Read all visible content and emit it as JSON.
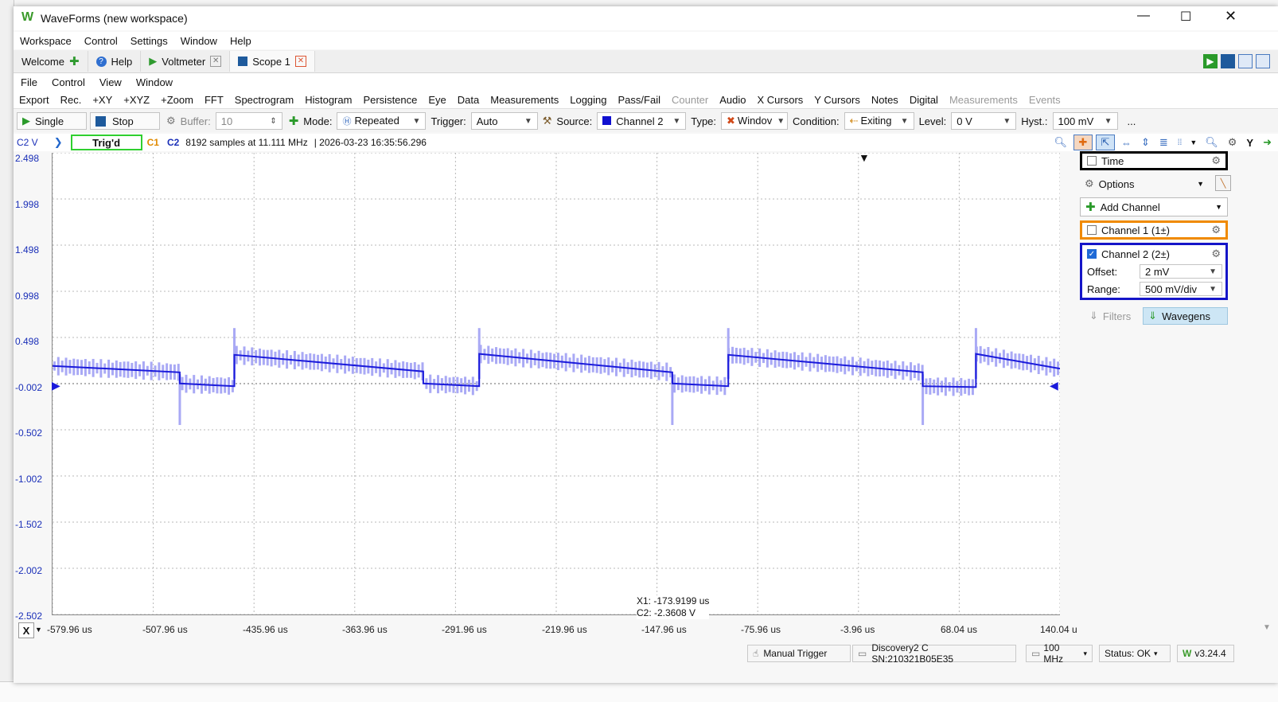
{
  "window": {
    "title": "WaveForms (new workspace)"
  },
  "menu": [
    "Workspace",
    "Control",
    "Settings",
    "Window",
    "Help"
  ],
  "tabs": [
    {
      "label": "Welcome"
    },
    {
      "label": "Help"
    },
    {
      "label": "Voltmeter"
    },
    {
      "label": "Scope 1"
    }
  ],
  "scope_menu": [
    "File",
    "Control",
    "View",
    "Window"
  ],
  "scope_tabs": [
    "Export",
    "Rec.",
    "+XY",
    "+XYZ",
    "+Zoom",
    "FFT",
    "Spectrogram",
    "Histogram",
    "Persistence",
    "Eye",
    "Data",
    "Measurements",
    "Logging",
    "Pass/Fail",
    "Counter",
    "Audio",
    "X Cursors",
    "Y Cursors",
    "Notes",
    "Digital",
    "Measurements",
    "Events"
  ],
  "controls": {
    "single": "Single",
    "stop": "Stop",
    "buffer_label": "Buffer:",
    "buffer_value": "10",
    "mode_label": "Mode:",
    "mode_value": "Repeated",
    "trigger_label": "Trigger:",
    "trigger_value": "Auto",
    "source_label": "Source:",
    "source_value": "Channel 2",
    "type_label": "Type:",
    "type_value": "Windov",
    "condition_label": "Condition:",
    "condition_value": "Exiting",
    "level_label": "Level:",
    "level_value": "0 V",
    "hyst_label": "Hyst.:",
    "hyst_value": "100 mV",
    "more": "..."
  },
  "info": {
    "channel_unit": "C2 V",
    "status": "Trig'd",
    "c1": "C1",
    "c2": "C2",
    "samples": "8192 samples at 11.111 MHz",
    "timestamp": "| 2026-03-23 16:35:56.296",
    "y_button": "Y"
  },
  "plot": {
    "y_ticks": [
      "2.498",
      "1.998",
      "1.498",
      "0.998",
      "0.498",
      "-0.002",
      "-0.502",
      "-1.002",
      "-1.502",
      "-2.002",
      "-2.502"
    ],
    "x_ticks": [
      "-579.96 us",
      "-507.96 us",
      "-435.96 us",
      "-363.96 us",
      "-291.96 us",
      "-219.96 us",
      "-147.96 us",
      "-75.96 us",
      "-3.96 us",
      "68.04 us",
      "140.04 u"
    ],
    "cursor_x1": "X1: -173.9199 us",
    "cursor_c2": "C2: -2.3608 V",
    "x_button": "X",
    "trace_color": "#1a1adb",
    "envelope_color": "#a9a9f5"
  },
  "chart_data": {
    "type": "line",
    "title": "",
    "xlabel": "",
    "ylabel": "C2 V",
    "xlim": [
      -579.96,
      140.04
    ],
    "ylim": [
      -2.502,
      2.498
    ],
    "series": [
      {
        "name": "C2",
        "x": [
          -579.96,
          -489.0,
          -489.0,
          -450.0,
          -450.0,
          -315.0,
          -315.0,
          -275.0,
          -275.0,
          -137.0,
          -137.0,
          -97.0,
          -97.0,
          42.0,
          42.0,
          80.0,
          80.0,
          140.04
        ],
        "y": [
          0.19,
          0.12,
          0.0,
          -0.03,
          0.31,
          0.13,
          0.0,
          -0.03,
          0.32,
          0.12,
          0.0,
          -0.03,
          0.31,
          0.12,
          -0.03,
          -0.04,
          0.32,
          0.16
        ]
      }
    ]
  },
  "side_panel": {
    "time": "Time",
    "options": "Options",
    "add_channel": "Add Channel",
    "channel1": "Channel 1 (1±)",
    "channel2": "Channel 2 (2±)",
    "offset_label": "Offset:",
    "offset_value": "2 mV",
    "range_label": "Range:",
    "range_value": "500 mV/div",
    "filters": "Filters",
    "wavegens": "Wavegens"
  },
  "status": {
    "manual_trigger": "Manual Trigger",
    "device": "Discovery2 C SN:210321B05E35",
    "clock": "100 MHz",
    "status": "Status: OK",
    "version": "v3.24.4"
  }
}
